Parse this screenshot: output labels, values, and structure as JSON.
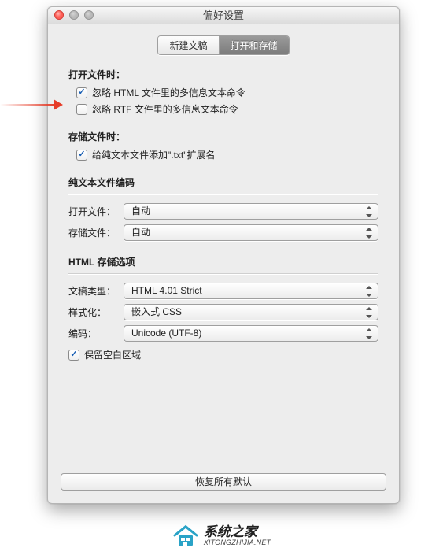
{
  "window": {
    "title": "偏好设置"
  },
  "tabs": {
    "new_doc": "新建文稿",
    "open_save": "打开和存储",
    "active_index": 1
  },
  "open_section": {
    "title": "打开文件时：",
    "ignore_html": {
      "label": "忽略 HTML 文件里的多信息文本命令",
      "checked": true
    },
    "ignore_rtf": {
      "label": "忽略 RTF 文件里的多信息文本命令",
      "checked": false
    }
  },
  "save_section": {
    "title": "存储文件时：",
    "add_txt_ext": {
      "label": "给纯文本文件添加\".txt\"扩展名",
      "checked": true
    }
  },
  "encoding_section": {
    "title": "纯文本文件编码",
    "open_label": "打开文件：",
    "open_value": "自动",
    "save_label": "存储文件：",
    "save_value": "自动"
  },
  "html_section": {
    "title": "HTML 存储选项",
    "doctype_label": "文稿类型：",
    "doctype_value": "HTML 4.01 Strict",
    "style_label": "样式化：",
    "style_value": "嵌入式 CSS",
    "encoding_label": "编码：",
    "encoding_value": "Unicode (UTF-8)",
    "preserve_blank": {
      "label": "保留空白区域",
      "checked": true
    }
  },
  "footer": {
    "reset_label": "恢复所有默认"
  },
  "watermark": {
    "cn": "系统之家",
    "en": "XITONGZHIJIA.NET"
  }
}
